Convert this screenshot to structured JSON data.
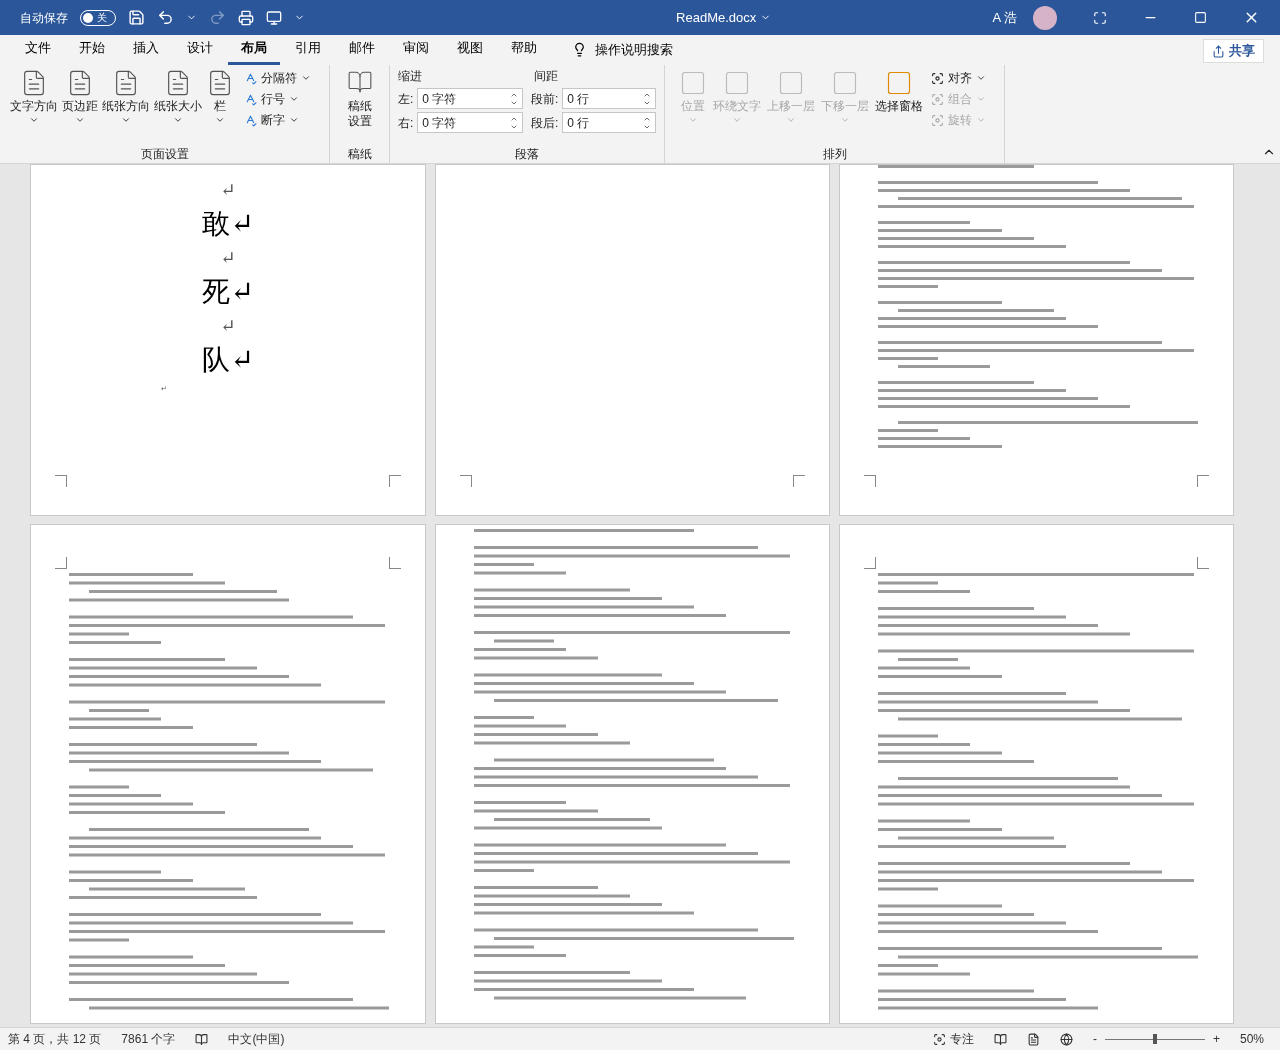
{
  "title_bar": {
    "autosave_label": "自动保存",
    "autosave": {
      "on": false,
      "label": "关"
    },
    "document_title": "ReadMe.docx",
    "user_name": "A 浩"
  },
  "tabs": [
    {
      "label": "文件",
      "selected": false
    },
    {
      "label": "开始",
      "selected": false
    },
    {
      "label": "插入",
      "selected": false
    },
    {
      "label": "设计",
      "selected": false
    },
    {
      "label": "布局",
      "selected": true
    },
    {
      "label": "引用",
      "selected": false
    },
    {
      "label": "邮件",
      "selected": false
    },
    {
      "label": "审阅",
      "selected": false
    },
    {
      "label": "视图",
      "selected": false
    },
    {
      "label": "帮助",
      "selected": false
    }
  ],
  "tell_me": "操作说明搜索",
  "share": "共享",
  "page_setup": {
    "title": "页面设置",
    "big_buttons": [
      "文字方向",
      "页边距",
      "纸张方向",
      "纸张大小",
      "栏"
    ],
    "small_buttons": [
      "分隔符",
      "行号",
      "断字"
    ]
  },
  "manuscript": {
    "title": "稿纸",
    "button": [
      "稿纸",
      "设置"
    ]
  },
  "paragraph": {
    "title": "段落",
    "indent_label": "缩进",
    "spacing_label": "间距",
    "fields": [
      {
        "label": "左:",
        "value": "0 字符"
      },
      {
        "label": "右:",
        "value": "0 字符"
      },
      {
        "label": "段前:",
        "value": "0 行"
      },
      {
        "label": "段后:",
        "value": "0 行"
      }
    ]
  },
  "arrange": {
    "title": "排列",
    "big_buttons": [
      {
        "label": "位置",
        "disabled": true
      },
      {
        "label": "环绕文字",
        "disabled": true
      },
      {
        "label": "上移一层",
        "disabled": true
      },
      {
        "label": "下移一层",
        "disabled": true
      },
      {
        "label": "选择窗格",
        "disabled": false
      }
    ],
    "small_buttons": [
      {
        "label": "对齐",
        "disabled": false
      },
      {
        "label": "组合",
        "disabled": true
      },
      {
        "label": "旋转",
        "disabled": true
      }
    ]
  },
  "first_page": {
    "lines": [
      "↵",
      "敢↵",
      "↵",
      "死↵",
      "↵",
      "队↵"
    ],
    "end_mark": "↵"
  },
  "status_bar": {
    "page": "第 4 页，共 12 页",
    "words": "7861 个字",
    "language": "中文(中国)",
    "focus": "专注",
    "zoom_minus": "-",
    "zoom_plus": "+",
    "zoom": "50%",
    "level": 0.5
  }
}
